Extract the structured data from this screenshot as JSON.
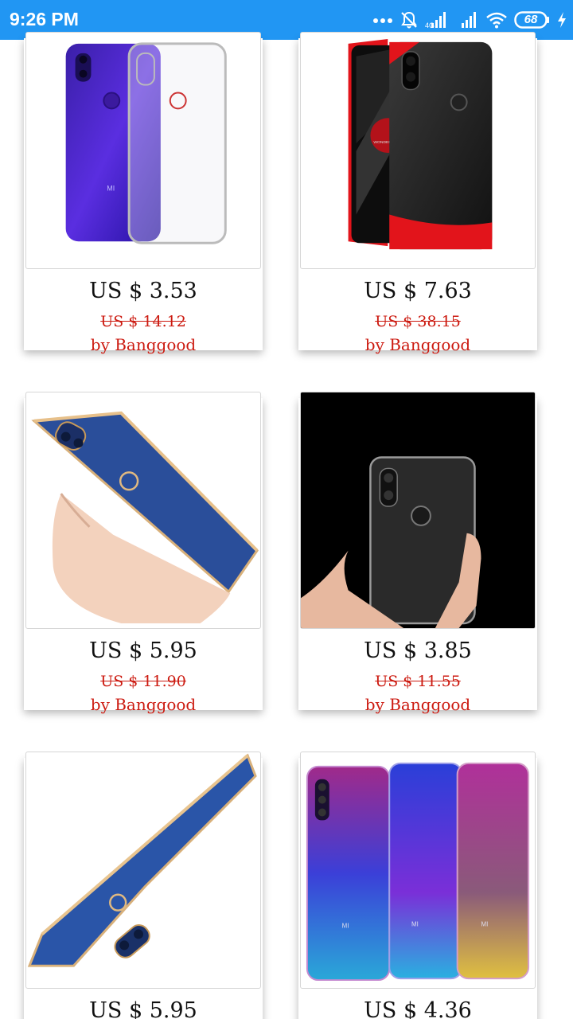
{
  "status_bar": {
    "time": "9:26 PM",
    "battery_level": "68",
    "icons": [
      "more-dots-icon",
      "mute-bell-icon",
      "signal-icon",
      "signal-icon",
      "wifi-icon",
      "battery-icon",
      "charging-bolt-icon"
    ]
  },
  "products": [
    {
      "image": "purple-phone-clear-case",
      "price": "US $ 3.53",
      "old_price": "US $ 14.12",
      "seller": "by Banggood"
    },
    {
      "image": "black-red-phone-case",
      "price": "US $ 7.63",
      "old_price": "US $ 38.15",
      "seller": "by Banggood"
    },
    {
      "image": "blue-gold-case-in-hand",
      "price": "US $ 5.95",
      "old_price": "US $ 11.90",
      "seller": "by Banggood"
    },
    {
      "image": "clear-case-black-background",
      "price": "US $ 3.85",
      "old_price": "US $ 11.55",
      "seller": "by Banggood"
    },
    {
      "image": "blue-gold-case-angled",
      "price": "US $ 5.95",
      "old_price": "",
      "seller": ""
    },
    {
      "image": "gradient-clear-cases",
      "price": "US $ 4.36",
      "old_price": "",
      "seller": ""
    }
  ],
  "colors": {
    "status_bar": "#2196f3",
    "sale_red": "#cc1a10"
  }
}
